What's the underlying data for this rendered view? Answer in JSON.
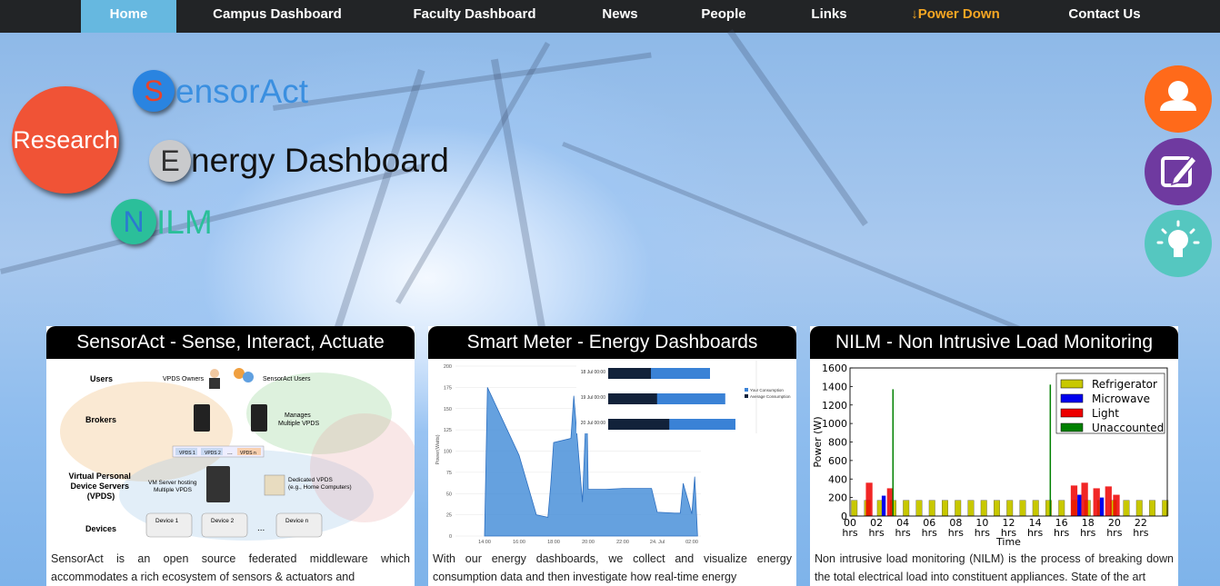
{
  "nav": {
    "items": [
      {
        "label": "Home",
        "active": true
      },
      {
        "label": "Campus Dashboard"
      },
      {
        "label": "Faculty Dashboard"
      },
      {
        "label": "News"
      },
      {
        "label": "People"
      },
      {
        "label": "Links"
      },
      {
        "label": "↓Power Down"
      },
      {
        "label": "Contact Us"
      }
    ]
  },
  "hero": {
    "research": "Research",
    "s_letter": "S",
    "sensoract": "ensorAct",
    "e_letter": "E",
    "energy": "nergy Dashboard",
    "n_letter": "N",
    "nilm": "ILM"
  },
  "side_buttons": [
    {
      "icon": "user-icon",
      "color": "#ff6a1a"
    },
    {
      "icon": "edit-icon",
      "color": "#6f3aa0"
    },
    {
      "icon": "lightbulb-icon",
      "color": "#55c7c0"
    }
  ],
  "cards": [
    {
      "title": "SensorAct - Sense, Interact, Actuate",
      "text": "SensorAct is an open source federated middleware which accommodates a rich ecosystem of sensors & actuators and",
      "diagram": {
        "rows": [
          "Users",
          "Brokers",
          "Virtual Personal Device Servers (VPDS)",
          "Devices"
        ],
        "owners": "VPDS Owners",
        "users": "SensorAct Users",
        "manages": "Manages Multiple VPDS",
        "vpds1": "VPDS 1",
        "vpds2": "VPDS 2",
        "vpdsdots": "...",
        "vpdsn": "VPDS n",
        "vmserver": "VM Server hosting Multiple VPDS",
        "dedicated": "Dedicated VPDS (e.g., Home Computers)",
        "dev1": "Device 1",
        "dev2": "Device 2",
        "devdots": "...",
        "devn": "Device n"
      }
    },
    {
      "title": "Smart Meter - Energy Dashboards",
      "text": "With our energy dashboards, we collect and visualize energy consumption data and then investigate how real-time energy"
    },
    {
      "title": "NILM - Non Intrusive Load Monitoring",
      "text": "Non intrusive load monitoring (NILM) is the process of breaking down the total electrical load into constituent appliances. State of the art"
    }
  ],
  "chart_data": [
    {
      "type": "area",
      "ylabel": "Power(Watts)",
      "y_ticks": [
        "0",
        "25",
        "50",
        "75",
        "100",
        "125",
        "150",
        "175",
        "200"
      ],
      "x_ticks": [
        "14:00",
        "16:00",
        "18:00",
        "20:00",
        "22:00",
        "24. Jul",
        "02:00"
      ],
      "series": [
        {
          "color": "#4a90d9",
          "x": [
            "14:00",
            "14:10",
            "16:00",
            "17:00",
            "17:40",
            "17:50",
            "18:00",
            "19:00",
            "19:10",
            "19:40",
            "19:55",
            "20:00",
            "21:00",
            "22:00",
            "23:00",
            "23:40",
            "24. Jul",
            "01:00",
            "01:20",
            "01:30",
            "02:00",
            "02:10",
            "02:20"
          ],
          "values": [
            0,
            175,
            95,
            25,
            22,
            60,
            110,
            115,
            165,
            40,
            165,
            55,
            55,
            56,
            56,
            56,
            28,
            27,
            27,
            62,
            26,
            70,
            0
          ]
        }
      ],
      "ylim": [
        0,
        200
      ]
    },
    {
      "type": "bar",
      "orientation": "horizontal",
      "categories": [
        "18 Jul 00:00",
        "19 Jul 00:00",
        "20 Jul 00:00"
      ],
      "series": [
        {
          "name": "Your Consumption",
          "values": [
            100,
            115,
            125
          ]
        },
        {
          "name": "Average Consumption",
          "values": [
            42,
            48,
            60
          ]
        }
      ]
    },
    {
      "type": "area",
      "ylabel": "Power (W)",
      "xlabel": "Time",
      "ylim": [
        0,
        1600
      ],
      "y_ticks": [
        "0",
        "200",
        "400",
        "600",
        "800",
        "1000",
        "1200",
        "1400",
        "1600"
      ],
      "x_ticks": [
        "00 hrs",
        "02 hrs",
        "04 hrs",
        "06 hrs",
        "08 hrs",
        "10 hrs",
        "12 hrs",
        "14 hrs",
        "16 hrs",
        "18 hrs",
        "20 hrs",
        "22 hrs"
      ],
      "legend": "top-right",
      "series": [
        {
          "name": "Refrigerator",
          "color": "#c8c800"
        },
        {
          "name": "Microwave",
          "color": "#0000ee"
        },
        {
          "name": "Light",
          "color": "#ee0000"
        },
        {
          "name": "Unaccounted",
          "color": "#008000"
        }
      ]
    }
  ]
}
